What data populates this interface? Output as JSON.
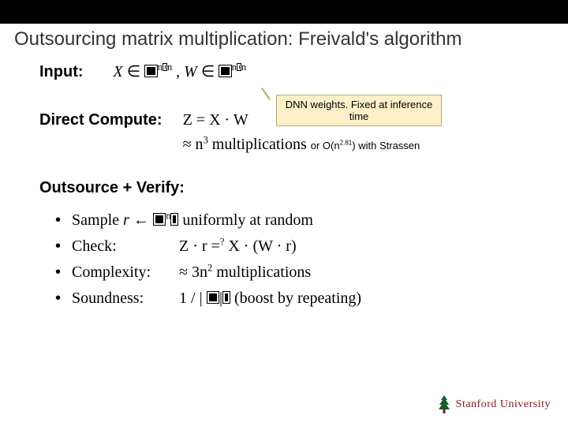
{
  "title": "Outsourcing matrix multiplication: Freivald's algorithm",
  "input": {
    "label": "Input:",
    "X": "X",
    "in": "∈",
    "exp_n": "n",
    "comma": ",",
    "W": "W"
  },
  "callout": "DNN weights. Fixed at inference time",
  "direct": {
    "label": "Direct Compute:",
    "eq": "Z = X · W",
    "approx_pre": "≈ n",
    "approx_exp": "3",
    "approx_post": " multiplications",
    "note": " or O(n",
    "note_exp": "2.81",
    "note_post": ") with Strassen"
  },
  "outsource": {
    "label": "Outsource + Verify:",
    "b1": {
      "text_pre": "Sample ",
      "r": "r",
      "arrow": " ← ",
      "exp": "n",
      "post": " uniformly at random"
    },
    "b2": {
      "label": "Check:",
      "eq_pre": "Z · r =",
      "q": "?",
      "eq_post": " X · (W · r)"
    },
    "b3": {
      "label": "Complexity:",
      "val_pre": "≈ 3n",
      "exp": "2",
      "val_post": " multiplications"
    },
    "b4": {
      "label": "Soundness:",
      "val_pre": "1 / | ",
      "val_mid": "|",
      "val_post": " (boost by repeating)"
    }
  },
  "footer": "Stanford University"
}
